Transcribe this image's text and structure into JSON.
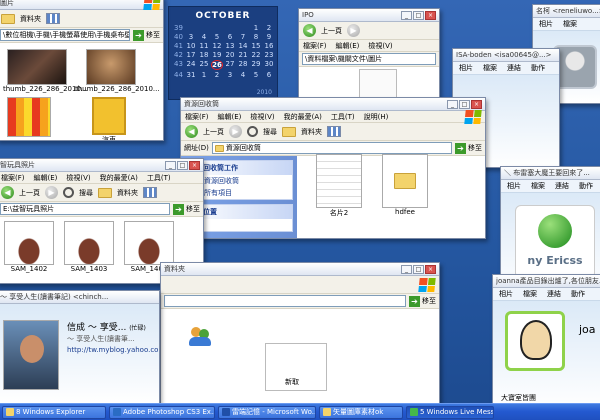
{
  "accent": "#245ad0",
  "calendar": {
    "month": "OCTOBER",
    "year": "2010",
    "today": "26",
    "rows": [
      [
        "39",
        "",
        "",
        "",
        "",
        "",
        "1",
        "2"
      ],
      [
        "40",
        "3",
        "4",
        "5",
        "6",
        "7",
        "8",
        "9"
      ],
      [
        "41",
        "10",
        "11",
        "12",
        "13",
        "14",
        "15",
        "16"
      ],
      [
        "42",
        "17",
        "18",
        "19",
        "20",
        "21",
        "22",
        "23"
      ],
      [
        "43",
        "24",
        "25",
        "26",
        "27",
        "28",
        "29",
        "30"
      ],
      [
        "44",
        "31",
        "1",
        "2",
        "3",
        "4",
        "5",
        "6"
      ]
    ]
  },
  "win_images": {
    "title": "圖片",
    "menu": [
      "檔案(F)",
      "編輯(E)",
      "檢視(V)",
      "我的最愛(A)",
      "工具(T)",
      "說明(H)"
    ],
    "toolbar": {
      "back": "上一頁",
      "folders": "資料夾"
    },
    "address": "\\數位相機\\手機\\手機螢幕使用\\手機桌布壁紙",
    "go": "移至",
    "thumbs": [
      "thumb_226_286_2010...",
      "thumb_226_286_2010..."
    ],
    "bottom_label": "汽車"
  },
  "win_cal_folder": {
    "title": "IPO",
    "toolbar": {
      "back": "上一頁",
      "folders": "資料夾"
    },
    "menu": [
      "檔案(F)",
      "編輯(E)",
      "檢視(V)",
      "我的最愛(A)",
      "工具(T)",
      "說明(H)"
    ],
    "address": "\\資料檔案\\機關文件\\圖片"
  },
  "win_recycle": {
    "title": "資源回收筒",
    "menu": [
      "檔案(F)",
      "編輯(E)",
      "檢視(V)",
      "我的最愛(A)",
      "工具(T)",
      "說明(H)"
    ],
    "toolbar": {
      "back": "上一頁",
      "search": "搜尋",
      "folders": "資料夾"
    },
    "address_label": "網址(D)",
    "address": "資源回收筒",
    "go": "移至",
    "task_title": "資源回收筒工作",
    "tasks": [
      "清理資源回收筒",
      "還原所有項目"
    ],
    "other_title": "其他位置",
    "other": [
      "桌面"
    ],
    "files": [
      {
        "name": "名片2"
      },
      {
        "name": "hdfee"
      }
    ]
  },
  "win_toys": {
    "title": "智玩具照片",
    "menu": [
      "檔案(F)",
      "編輯(E)",
      "檢視(V)",
      "我的最愛(A)",
      "工具(T)",
      "說明(H)"
    ],
    "toolbar": {
      "back": "上一頁",
      "search": "搜尋",
      "folders": "資料夾"
    },
    "address": "E:\\益智玩具照片",
    "go": "移至",
    "photos": [
      "SAM_1402",
      "SAM_1403",
      "SAM_1404"
    ]
  },
  "win_blog": {
    "title": "～ 享受人生(讀書筆記) <chinch...",
    "name": "信成 ～ 享受...",
    "name_suffix": "(忙碌)",
    "status": "～ 享受人生(讀書筆...",
    "url": "http://tw.myblog.yahoo.co..."
  },
  "win_contacts": {
    "title": "資料夾",
    "label": "新取"
  },
  "msn_isa": {
    "title": "ISA-boden <isa00645@...>",
    "menu": [
      "相片",
      "檔案",
      "連結",
      "動作"
    ]
  },
  "msn_top": {
    "title": "名柯 <reneliuwo...>",
    "menu": [
      "相片",
      "檔案",
      "連結"
    ]
  },
  "msn_ericsson": {
    "title": "＼ 布雷塞大魔王要回來了...",
    "menu": [
      "相片",
      "檔案",
      "連結",
      "動作"
    ],
    "logo_text": "ny Ericss"
  },
  "msn_joanna": {
    "title": "joanna產品目錄出爐了,各位朋友...",
    "menu": [
      "相片",
      "檔案",
      "連結",
      "動作"
    ],
    "name": "joa",
    "footer": "大寶室皆團"
  },
  "taskbar": {
    "items": [
      "8 Windows Explorer",
      "Adobe Photoshop CS3 Ex...",
      "雷端記憶 - Microsoft Wo...",
      "矢量圖庫素材ok",
      "5 Windows Live Messen..."
    ]
  }
}
